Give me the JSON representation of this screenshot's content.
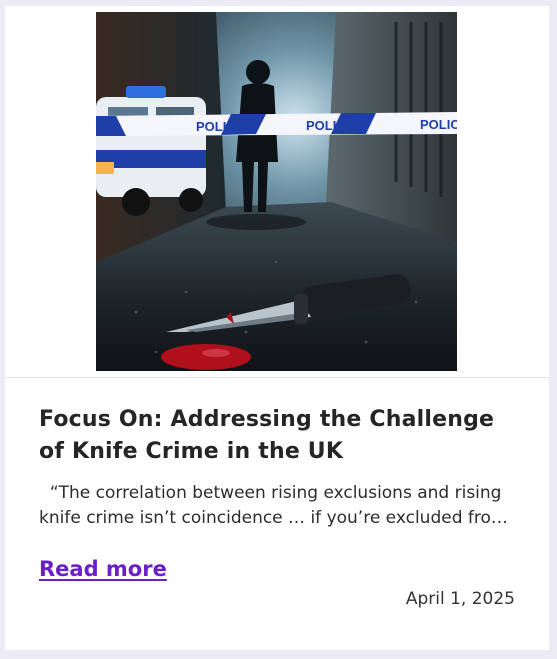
{
  "post": {
    "image_alt": "police-tape-crime-scene-knife",
    "tape_text": [
      "POLICE",
      "POLICE",
      "POLIC"
    ],
    "title": "Focus On: Addressing the Challenge of Knife Crime in the UK",
    "excerpt": "  “The correlation between rising exclusions and rising knife crime isn’t coincidence … if you’re excluded fro…",
    "read_more_label": "Read more",
    "date": "April 1, 2025"
  },
  "colors": {
    "link": "#6b1fc9",
    "page_background": "#ecebf6",
    "tape_blue": "#1f3fa8"
  }
}
